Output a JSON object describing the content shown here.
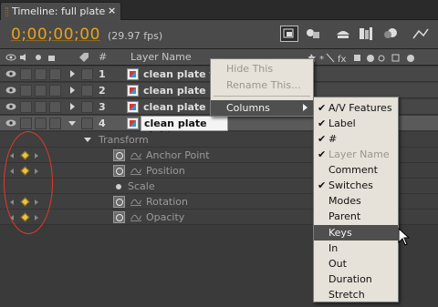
{
  "tab": {
    "title": "Timeline: full plate",
    "close": "×"
  },
  "toolbar": {
    "timecode": "0;00;00;00",
    "fps": "(29.97 fps)"
  },
  "header": {
    "hash": "#",
    "layer_name_col": "Layer Name"
  },
  "layers": [
    {
      "num": "1",
      "name": "clean plate to"
    },
    {
      "num": "2",
      "name": "clean plate bo"
    },
    {
      "num": "3",
      "name": "clean plate le"
    },
    {
      "num": "4",
      "name": "clean plate right"
    }
  ],
  "transform": {
    "label": "Transform",
    "properties": [
      "Anchor Point",
      "Position",
      "Scale",
      "Rotation",
      "Opacity"
    ]
  },
  "context_menu": {
    "items": [
      {
        "label": "Hide This",
        "disabled": true
      },
      {
        "label": "Rename This...",
        "disabled": true
      },
      {
        "label": "Columns",
        "disabled": false
      }
    ]
  },
  "columns_submenu": {
    "items": [
      {
        "label": "A/V Features",
        "checked": true,
        "disabled": false
      },
      {
        "label": "Label",
        "checked": true,
        "disabled": false
      },
      {
        "label": "#",
        "checked": true,
        "disabled": false
      },
      {
        "label": "Layer Name",
        "checked": true,
        "disabled": true
      },
      {
        "label": "Comment",
        "checked": false,
        "disabled": false
      },
      {
        "label": "Switches",
        "checked": true,
        "disabled": false
      },
      {
        "label": "Modes",
        "checked": false,
        "disabled": false
      },
      {
        "label": "Parent",
        "checked": false,
        "disabled": false
      },
      {
        "label": "Keys",
        "checked": false,
        "disabled": false,
        "highlighted": true
      },
      {
        "label": "In",
        "checked": false,
        "disabled": false
      },
      {
        "label": "Out",
        "checked": false,
        "disabled": false
      },
      {
        "label": "Duration",
        "checked": false,
        "disabled": false
      },
      {
        "label": "Stretch",
        "checked": false,
        "disabled": false
      }
    ]
  },
  "colors": {
    "timecode": "#e8a21a",
    "annotation": "#e13a2a",
    "keyframe": "#e8c34a"
  }
}
